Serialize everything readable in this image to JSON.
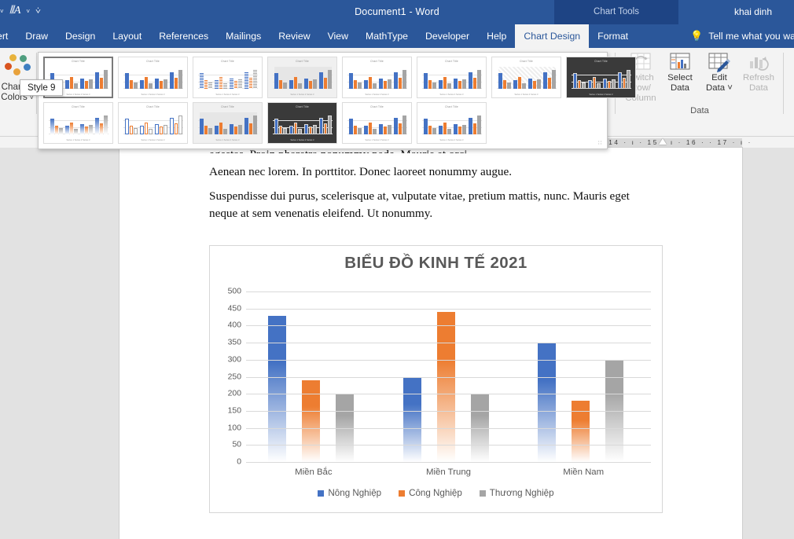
{
  "titlebar": {
    "document_title": "Document1  -  Word",
    "contextual_tools": "Chart Tools",
    "user_name": "khai dinh",
    "qat_icons": [
      "chevron-down",
      "format-painter",
      "chevron-down",
      "more-commands"
    ]
  },
  "tabs": [
    {
      "label": "nsert",
      "active": false
    },
    {
      "label": "Draw",
      "active": false
    },
    {
      "label": "Design",
      "active": false
    },
    {
      "label": "Layout",
      "active": false
    },
    {
      "label": "References",
      "active": false
    },
    {
      "label": "Mailings",
      "active": false
    },
    {
      "label": "Review",
      "active": false
    },
    {
      "label": "View",
      "active": false
    },
    {
      "label": "MathType",
      "active": false
    },
    {
      "label": "Developer",
      "active": false
    },
    {
      "label": "Help",
      "active": false
    },
    {
      "label": "Chart Design",
      "active": true
    },
    {
      "label": "Format",
      "active": false
    }
  ],
  "tellme": {
    "label": "Tell me what you wa",
    "icon": "lightbulb-icon"
  },
  "ribbon": {
    "change_colors": {
      "label_line1": "Change",
      "label_line2": "Colors",
      "dropdown": "˅",
      "dot_colors": [
        "#e8b33c",
        "#4f9e7f",
        "#d9541f",
        "#3f7fc1",
        "#e8a23c"
      ]
    },
    "chart_styles_group_label": "",
    "data_group": {
      "title": "Data",
      "buttons": [
        {
          "name": "switch-row-column",
          "line1": "Switch Row/",
          "line2": "Column",
          "disabled": true
        },
        {
          "name": "select-data",
          "line1": "Select",
          "line2": "Data",
          "disabled": false
        },
        {
          "name": "edit-data",
          "line1": "Edit",
          "line2": "Data ˅",
          "disabled": false
        },
        {
          "name": "refresh-data",
          "line1": "Refresh",
          "line2": "Data",
          "disabled": true
        }
      ]
    }
  },
  "gallery": {
    "tooltip": "Style 9",
    "selected_index": 0,
    "row1": [
      {
        "variant": "plain",
        "selected": true
      },
      {
        "variant": "subtitle",
        "selected": false
      },
      {
        "variant": "striped",
        "selected": false
      },
      {
        "variant": "grayplot",
        "selected": false
      },
      {
        "variant": "plain",
        "selected": false
      },
      {
        "variant": "plain",
        "selected": false
      },
      {
        "variant": "hatched",
        "selected": false
      },
      {
        "variant": "dark",
        "selected": false
      }
    ],
    "row2": [
      {
        "variant": "gradient",
        "selected": false
      },
      {
        "variant": "outline",
        "selected": false
      },
      {
        "variant": "bandplot",
        "selected": false
      },
      {
        "variant": "dark",
        "selected": false
      },
      {
        "variant": "plain",
        "selected": false
      },
      {
        "variant": "plain",
        "selected": false
      }
    ]
  },
  "ruler": {
    "marks": "· 14 ·  ı  · 15 ·  ı  · 16 ·     · 17 ·  ı  ·"
  },
  "document": {
    "paragraphs": [
      "egestas. Proin pharetra nonummy pede. Mauris et orci.",
      "Aenean nec lorem. In porttitor. Donec laoreet nonummy augue.",
      "Suspendisse dui purus, scelerisque at, vulputate vitae, pretium mattis, nunc. Mauris eget",
      "neque at sem venenatis eleifend. Ut nonummy."
    ]
  },
  "chart_data": {
    "type": "bar",
    "title": "BIỂU ĐỒ KINH TẾ 2021",
    "categories": [
      "Miền Bắc",
      "Miền Trung",
      "Miền Nam"
    ],
    "series": [
      {
        "name": "Nông Nghiệp",
        "color": "#4472c4",
        "values": [
          428,
          250,
          350
        ]
      },
      {
        "name": "Công Nghiệp",
        "color": "#ed7d31",
        "values": [
          240,
          440,
          180
        ]
      },
      {
        "name": "Thương Nghiệp",
        "color": "#a5a5a5",
        "values": [
          200,
          200,
          300
        ]
      }
    ],
    "xlabel": "",
    "ylabel": "",
    "ylim": [
      0,
      500
    ],
    "ytick_step": 50,
    "yticks": [
      500,
      450,
      400,
      350,
      300,
      250,
      200,
      150,
      100,
      50,
      0
    ],
    "grid": true,
    "legend_position": "bottom",
    "bar_fill": "gradient-to-white"
  },
  "colors": {
    "word_blue": "#2b579a",
    "contextual_blue": "#1e4484",
    "ribbon_bg": "#f3f3f3",
    "series_blue": "#4472c4",
    "series_orange": "#ed7d31",
    "series_gray": "#a5a5a5",
    "chart_title_gray": "#595959"
  }
}
